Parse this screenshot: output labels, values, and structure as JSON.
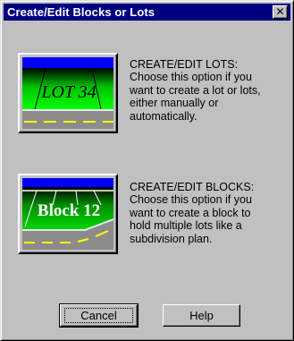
{
  "window": {
    "title": "Create/Edit Blocks or Lots",
    "close_glyph": "✕"
  },
  "options": [
    {
      "id": "lots",
      "image_label": "LOT 34",
      "lines": [
        "CREATE/EDIT LOTS:",
        "Choose this option if you",
        "want to create a lot or lots,",
        "either manually or",
        "automatically."
      ]
    },
    {
      "id": "blocks",
      "image_label": "Block 12",
      "lines": [
        "CREATE/EDIT BLOCKS:",
        "Choose this option if you",
        "want to create a block to",
        "hold multiple lots like a",
        "subdivision plan."
      ]
    }
  ],
  "buttons": {
    "cancel": "Cancel",
    "help": "Help"
  },
  "colors": {
    "title_bar": "#000080",
    "face": "#c0c0c0",
    "sky": "#0000ff",
    "grass": "#00b000",
    "road": "#8c8c8c",
    "road_lines": "#ffff00"
  }
}
